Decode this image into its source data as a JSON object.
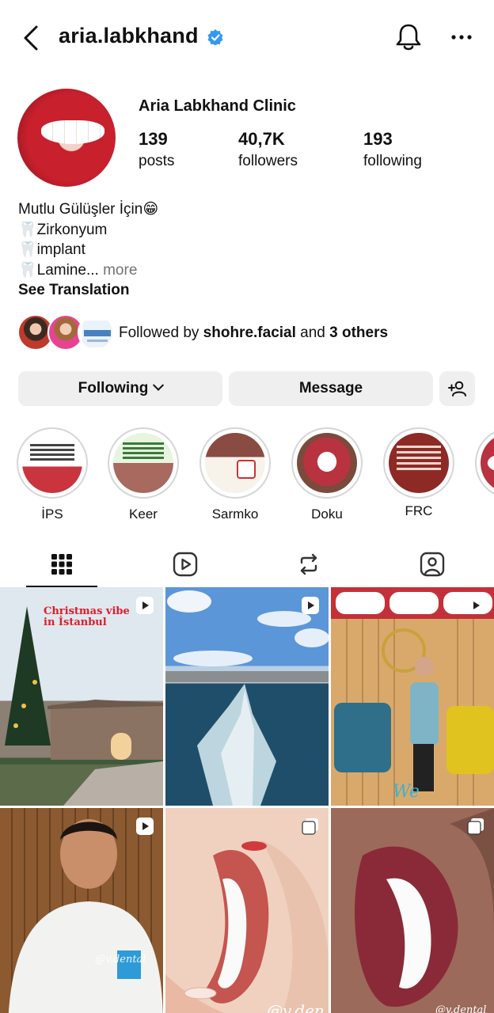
{
  "header": {
    "username": "aria.labkhand",
    "verified": true,
    "icons": [
      "back-arrow-icon",
      "verified-badge-icon",
      "bell-icon",
      "more-dots-icon"
    ]
  },
  "profile": {
    "full_name": "Aria Labkhand Clinic",
    "stats": [
      {
        "value": "139",
        "label": "posts"
      },
      {
        "value": "40,7K",
        "label": "followers"
      },
      {
        "value": "193",
        "label": "following"
      }
    ],
    "bio": {
      "line1": "Mutlu Gülüşler İçin😁",
      "line2": "🦷Zirkonyum",
      "line3": "🦷implant",
      "line4": "🦷Lamine...",
      "more": " more",
      "see_translation": "See Translation"
    },
    "followed_by": {
      "prefix": "Followed by ",
      "user": "shohre.facial",
      "middle": " and ",
      "others": "3 others"
    }
  },
  "actions": {
    "following": "Following",
    "message": "Message",
    "add_user_icon": "add-person-icon"
  },
  "highlights": [
    {
      "label": "İPS"
    },
    {
      "label": "Keer"
    },
    {
      "label": "Sarmko"
    },
    {
      "label": "Doku"
    },
    {
      "label": "FRC"
    }
  ],
  "tabs": [
    "grid-icon",
    "reels-icon",
    "repost-icon",
    "tagged-icon"
  ],
  "posts": [
    {
      "caption": "Christmas vibe in İstanbul",
      "badge": "reel"
    },
    {
      "caption": "",
      "badge": "reel"
    },
    {
      "caption": "",
      "badge": "reel",
      "watermark": "We"
    },
    {
      "caption": "@v.dental",
      "badge": "reel"
    },
    {
      "caption": "@v.den",
      "badge": "multi"
    },
    {
      "caption": "@v.dental",
      "badge": "multi"
    }
  ],
  "colors": {
    "verified": "#3797f0",
    "button_bg": "#efefef",
    "text": "#111111",
    "muted": "#737373"
  }
}
